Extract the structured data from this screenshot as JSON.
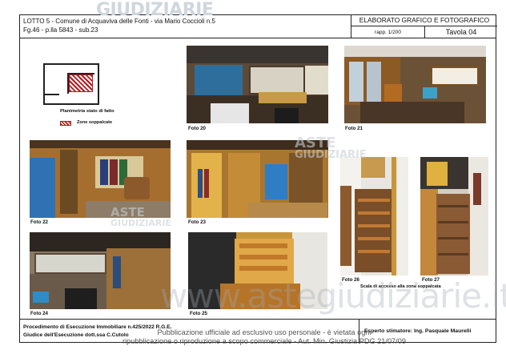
{
  "watermark_top": "GIUDIZIARIE",
  "header": {
    "line1": "LOTTO 5 - Comune di Acquaviva delle Fonti - via Mario Coccioli n.5",
    "line2": "Fg.46 - p.lla 5843 - sub.23",
    "title": "ELABORATO GRAFICO E FOTOGRAFICO",
    "scale": "rapp. 1/200",
    "table": "Tavola 04"
  },
  "plan": {
    "caption": "Planimetria stato di fatto",
    "legend": "Zone soppalcate"
  },
  "photos": {
    "p20": "Foto 20",
    "p21": "Foto 21",
    "p22": "Foto 22",
    "p23": "Foto 23",
    "p24": "Foto 24",
    "p25": "Foto 25",
    "p26": "Foto 26",
    "p27": "Foto 27",
    "stair_caption": "Scala di accesso alla zona soppalcata"
  },
  "watermarks": {
    "aste1": "ASTE",
    "giud1": "GIUDIZIARIE",
    "aste2": "ASTE",
    "giud2": "GIUDIZIARIE",
    "big": "www.astegiudiziarie.it"
  },
  "footer": {
    "line1": "Procedimento di Esecuzione Immobiliare n.425/2022 R.G.E.",
    "line2": "Giudice dell'Esecuzione dott.ssa C.Cutolo",
    "expert": "Esperto stimatore: Ing. Pasquale Maurelli"
  },
  "publication": {
    "line1": "Pubblicazione ufficiale ad esclusivo uso personale - è vietata ogni",
    "line2": "ripubblicazione o riproduzione a scopo commerciale - Aut. Min. Giustizia PDG 21/07/09"
  }
}
